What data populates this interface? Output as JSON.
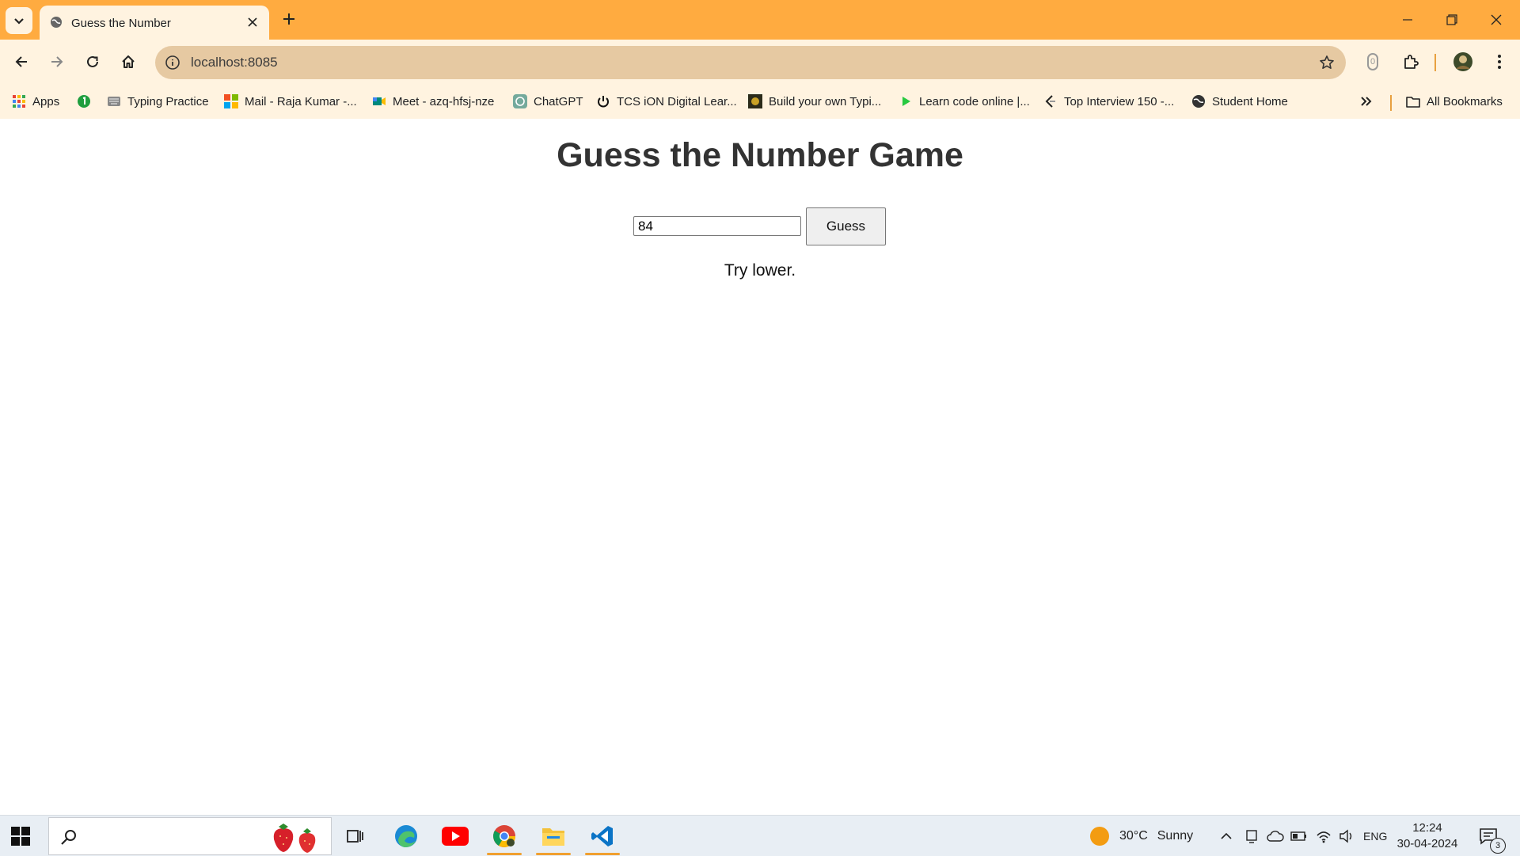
{
  "browser": {
    "tab_title": "Guess the Number",
    "url": "localhost:8085",
    "extension_badge": "0"
  },
  "bookmarks": [
    {
      "label": "Apps",
      "icon": "apps-grid-icon"
    },
    {
      "label": "",
      "icon": "green-circle-badge-icon"
    },
    {
      "label": "Typing Practice",
      "icon": "typing-icon"
    },
    {
      "label": "Mail - Raja Kumar -...",
      "icon": "microsoft-icon"
    },
    {
      "label": "Meet - azq-hfsj-nze",
      "icon": "meet-icon"
    },
    {
      "label": "ChatGPT",
      "icon": "chatgpt-icon"
    },
    {
      "label": "TCS iON Digital Lear...",
      "icon": "power-icon"
    },
    {
      "label": "Build your own Typi...",
      "icon": "build-icon"
    },
    {
      "label": "Learn code online |...",
      "icon": "play-icon"
    },
    {
      "label": "Top Interview 150 -...",
      "icon": "leetcode-icon"
    },
    {
      "label": "Student Home",
      "icon": "globe-icon"
    }
  ],
  "bookmarks_all_label": "All Bookmarks",
  "page": {
    "heading": "Guess the Number Game",
    "input_value": "84",
    "button_label": "Guess",
    "message": "Try lower."
  },
  "taskbar": {
    "weather_temp": "30°C",
    "weather_text": "Sunny",
    "language": "ENG",
    "time": "12:24",
    "date": "30-04-2024",
    "notification_count": "3"
  },
  "colors": {
    "tabstrip": "#ffab40",
    "toolbar": "#fff3e0",
    "omnibox": "#e6c9a2"
  }
}
